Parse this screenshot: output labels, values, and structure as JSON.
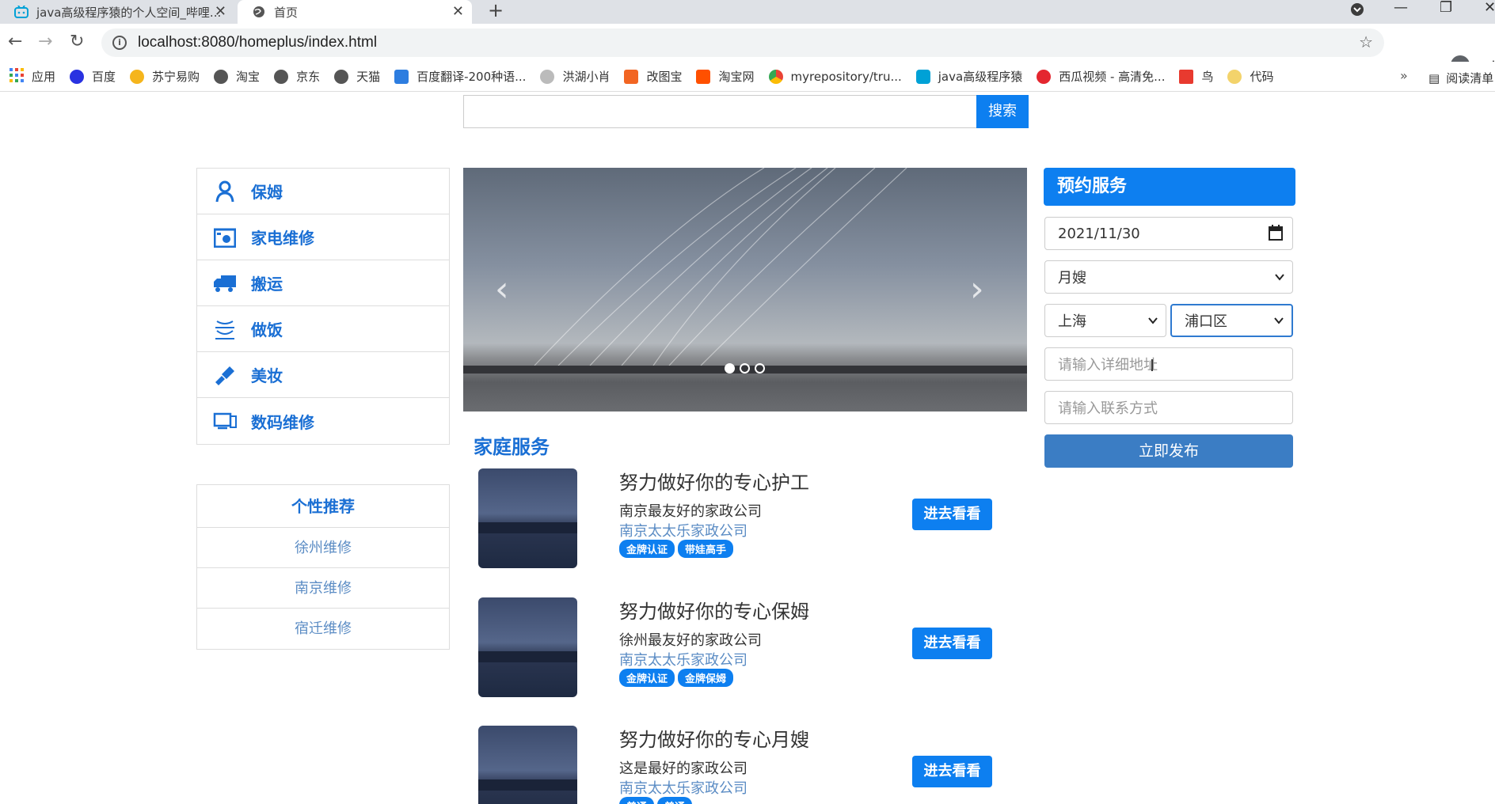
{
  "browser": {
    "tabs": [
      {
        "title": "java高级程序猿的个人空间_哔哩..."
      },
      {
        "title": "首页"
      }
    ],
    "url": "localhost:8080/homeplus/index.html",
    "bookmarks": [
      {
        "label": "应用",
        "color": "#4285f4"
      },
      {
        "label": "百度",
        "color": "#2932e1"
      },
      {
        "label": "苏宁易购",
        "color": "#f5b51c"
      },
      {
        "label": "淘宝",
        "color": "#555555"
      },
      {
        "label": "京东",
        "color": "#555555"
      },
      {
        "label": "天猫",
        "color": "#555555"
      },
      {
        "label": "百度翻译-200种语...",
        "color": "#2d7de0"
      },
      {
        "label": "洪湖小肖",
        "color": "#888888"
      },
      {
        "label": "改图宝",
        "color": "#f26522"
      },
      {
        "label": "淘宝网",
        "color": "#ff5000"
      },
      {
        "label": "myrepository/tru...",
        "color": "#2b9b48"
      },
      {
        "label": "java高级程序猿",
        "color": "#00a1d6"
      },
      {
        "label": "西瓜视频 - 高清免...",
        "color": "#e4262f"
      },
      {
        "label": "鸟",
        "color": "#e83a2f"
      },
      {
        "label": "代码",
        "color": "#f3d36b"
      }
    ],
    "reading_list": "阅读清单"
  },
  "search": {
    "placeholder": "",
    "button": "搜索"
  },
  "categories": [
    {
      "label": "保姆",
      "icon": "nanny-icon"
    },
    {
      "label": "家电维修",
      "icon": "appliance-repair-icon"
    },
    {
      "label": "搬运",
      "icon": "truck-icon"
    },
    {
      "label": "做饭",
      "icon": "cooking-icon"
    },
    {
      "label": "美妆",
      "icon": "makeup-icon"
    },
    {
      "label": "数码维修",
      "icon": "digital-repair-icon"
    }
  ],
  "recommend": {
    "title": "个性推荐",
    "items": [
      "徐州维修",
      "南京维修",
      "宿迁维修"
    ]
  },
  "carousel": {
    "slide_count": 3,
    "active": 0
  },
  "section_title": "家庭服务",
  "services": [
    {
      "title": "努力做好你的专心护工",
      "desc": "南京最友好的家政公司",
      "company": "南京太太乐家政公司",
      "tags": [
        "金牌认证",
        "带娃高手"
      ],
      "button": "进去看看"
    },
    {
      "title": "努力做好你的专心保姆",
      "desc": "徐州最友好的家政公司",
      "company": "南京太太乐家政公司",
      "tags": [
        "金牌认证",
        "金牌保姆"
      ],
      "button": "进去看看"
    },
    {
      "title": "努力做好你的专心月嫂",
      "desc": "这是最好的家政公司",
      "company": "南京太太乐家政公司",
      "tags": [
        "普通",
        "普通"
      ],
      "button": "进去看看"
    }
  ],
  "booking": {
    "title": "预约服务",
    "date": "2021/11/30",
    "service_type": "月嫂",
    "city": "上海",
    "district": "浦口区",
    "address_placeholder": "请输入详细地址",
    "contact_placeholder": "请输入联系方式",
    "submit": "立即发布"
  },
  "colors": {
    "accent": "#0d7ff0",
    "link": "#5b8cc4",
    "menu_text": "#1a6fd4",
    "publish": "#3b7dc4"
  }
}
